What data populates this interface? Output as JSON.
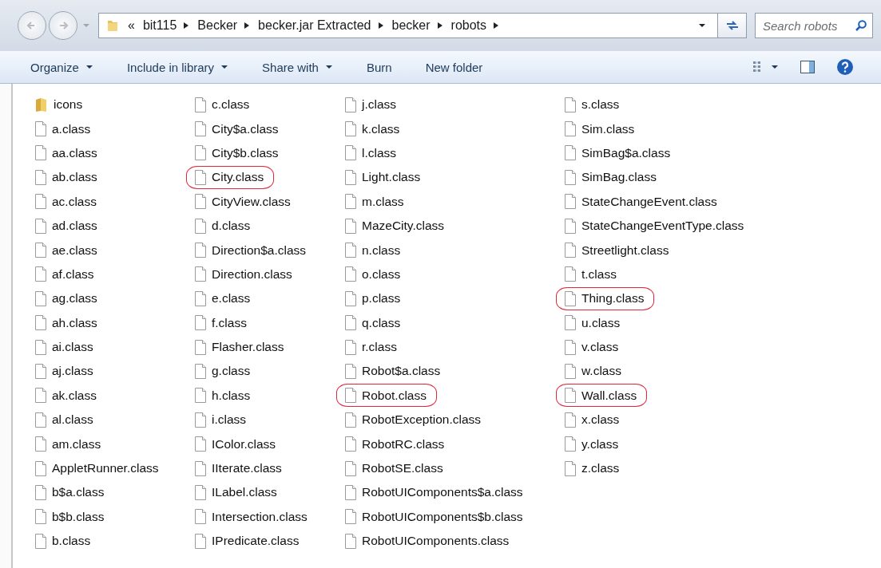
{
  "address_bar": {
    "overflow": "«",
    "segments": [
      "bit115",
      "Becker",
      "becker.jar Extracted",
      "becker",
      "robots"
    ]
  },
  "search": {
    "placeholder": "Search robots"
  },
  "toolbar": {
    "buttons": [
      {
        "label": "Organize",
        "dropdown": true
      },
      {
        "label": "Include in library",
        "dropdown": true
      },
      {
        "label": "Share with",
        "dropdown": true
      },
      {
        "label": "Burn",
        "dropdown": false
      },
      {
        "label": "New folder",
        "dropdown": false
      }
    ]
  },
  "files": {
    "columns": [
      [
        {
          "name": "icons",
          "kind": "folder",
          "circled": false
        },
        {
          "name": "a.class",
          "kind": "file",
          "circled": false
        },
        {
          "name": "aa.class",
          "kind": "file",
          "circled": false
        },
        {
          "name": "ab.class",
          "kind": "file",
          "circled": false
        },
        {
          "name": "ac.class",
          "kind": "file",
          "circled": false
        },
        {
          "name": "ad.class",
          "kind": "file",
          "circled": false
        },
        {
          "name": "ae.class",
          "kind": "file",
          "circled": false
        },
        {
          "name": "af.class",
          "kind": "file",
          "circled": false
        },
        {
          "name": "ag.class",
          "kind": "file",
          "circled": false
        },
        {
          "name": "ah.class",
          "kind": "file",
          "circled": false
        },
        {
          "name": "ai.class",
          "kind": "file",
          "circled": false
        },
        {
          "name": "aj.class",
          "kind": "file",
          "circled": false
        },
        {
          "name": "ak.class",
          "kind": "file",
          "circled": false
        },
        {
          "name": "al.class",
          "kind": "file",
          "circled": false
        },
        {
          "name": "am.class",
          "kind": "file",
          "circled": false
        },
        {
          "name": "AppletRunner.class",
          "kind": "file",
          "circled": false
        },
        {
          "name": "b$a.class",
          "kind": "file",
          "circled": false
        },
        {
          "name": "b$b.class",
          "kind": "file",
          "circled": false
        },
        {
          "name": "b.class",
          "kind": "file",
          "circled": false
        }
      ],
      [
        {
          "name": "c.class",
          "kind": "file",
          "circled": false
        },
        {
          "name": "City$a.class",
          "kind": "file",
          "circled": false
        },
        {
          "name": "City$b.class",
          "kind": "file",
          "circled": false
        },
        {
          "name": "City.class",
          "kind": "file",
          "circled": true
        },
        {
          "name": "CityView.class",
          "kind": "file",
          "circled": false
        },
        {
          "name": "d.class",
          "kind": "file",
          "circled": false
        },
        {
          "name": "Direction$a.class",
          "kind": "file",
          "circled": false
        },
        {
          "name": "Direction.class",
          "kind": "file",
          "circled": false
        },
        {
          "name": "e.class",
          "kind": "file",
          "circled": false
        },
        {
          "name": "f.class",
          "kind": "file",
          "circled": false
        },
        {
          "name": "Flasher.class",
          "kind": "file",
          "circled": false
        },
        {
          "name": "g.class",
          "kind": "file",
          "circled": false
        },
        {
          "name": "h.class",
          "kind": "file",
          "circled": false
        },
        {
          "name": "i.class",
          "kind": "file",
          "circled": false
        },
        {
          "name": "IColor.class",
          "kind": "file",
          "circled": false
        },
        {
          "name": "IIterate.class",
          "kind": "file",
          "circled": false
        },
        {
          "name": "ILabel.class",
          "kind": "file",
          "circled": false
        },
        {
          "name": "Intersection.class",
          "kind": "file",
          "circled": false
        },
        {
          "name": "IPredicate.class",
          "kind": "file",
          "circled": false
        }
      ],
      [
        {
          "name": "j.class",
          "kind": "file",
          "circled": false
        },
        {
          "name": "k.class",
          "kind": "file",
          "circled": false
        },
        {
          "name": "l.class",
          "kind": "file",
          "circled": false
        },
        {
          "name": "Light.class",
          "kind": "file",
          "circled": false
        },
        {
          "name": "m.class",
          "kind": "file",
          "circled": false
        },
        {
          "name": "MazeCity.class",
          "kind": "file",
          "circled": false
        },
        {
          "name": "n.class",
          "kind": "file",
          "circled": false
        },
        {
          "name": "o.class",
          "kind": "file",
          "circled": false
        },
        {
          "name": "p.class",
          "kind": "file",
          "circled": false
        },
        {
          "name": "q.class",
          "kind": "file",
          "circled": false
        },
        {
          "name": "r.class",
          "kind": "file",
          "circled": false
        },
        {
          "name": "Robot$a.class",
          "kind": "file",
          "circled": false
        },
        {
          "name": "Robot.class",
          "kind": "file",
          "circled": true
        },
        {
          "name": "RobotException.class",
          "kind": "file",
          "circled": false
        },
        {
          "name": "RobotRC.class",
          "kind": "file",
          "circled": false
        },
        {
          "name": "RobotSE.class",
          "kind": "file",
          "circled": false
        },
        {
          "name": "RobotUIComponents$a.class",
          "kind": "file",
          "circled": false
        },
        {
          "name": "RobotUIComponents$b.class",
          "kind": "file",
          "circled": false
        },
        {
          "name": "RobotUIComponents.class",
          "kind": "file",
          "circled": false
        }
      ],
      [
        {
          "name": "s.class",
          "kind": "file",
          "circled": false
        },
        {
          "name": "Sim.class",
          "kind": "file",
          "circled": false
        },
        {
          "name": "SimBag$a.class",
          "kind": "file",
          "circled": false
        },
        {
          "name": "SimBag.class",
          "kind": "file",
          "circled": false
        },
        {
          "name": "StateChangeEvent.class",
          "kind": "file",
          "circled": false
        },
        {
          "name": "StateChangeEventType.class",
          "kind": "file",
          "circled": false
        },
        {
          "name": "Streetlight.class",
          "kind": "file",
          "circled": false
        },
        {
          "name": "t.class",
          "kind": "file",
          "circled": false
        },
        {
          "name": "Thing.class",
          "kind": "file",
          "circled": true
        },
        {
          "name": "u.class",
          "kind": "file",
          "circled": false
        },
        {
          "name": "v.class",
          "kind": "file",
          "circled": false
        },
        {
          "name": "w.class",
          "kind": "file",
          "circled": false
        },
        {
          "name": "Wall.class",
          "kind": "file",
          "circled": true
        },
        {
          "name": "x.class",
          "kind": "file",
          "circled": false
        },
        {
          "name": "y.class",
          "kind": "file",
          "circled": false
        },
        {
          "name": "z.class",
          "kind": "file",
          "circled": false
        }
      ]
    ]
  }
}
